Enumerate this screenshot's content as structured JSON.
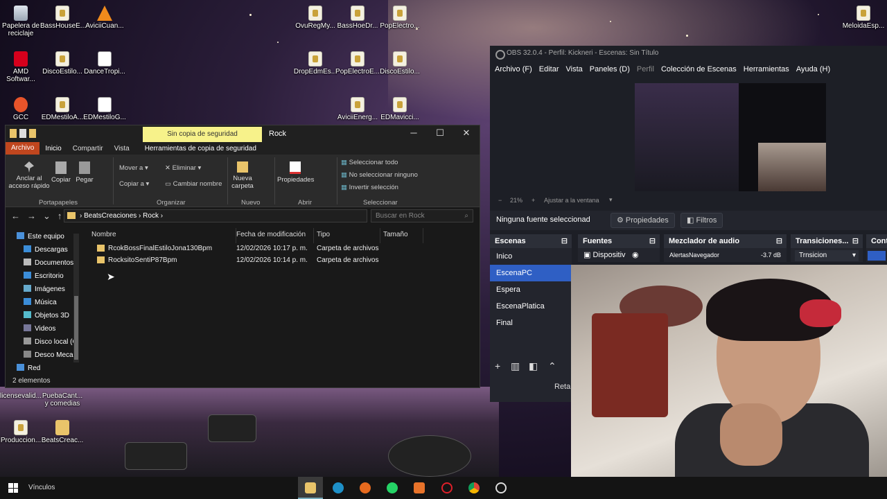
{
  "desktop": {
    "icons": [
      {
        "label": "Papelera de reciclaje"
      },
      {
        "label": "BassHouseE..."
      },
      {
        "label": "AviciiCuan..."
      },
      {
        "label": "OvuRegMy..."
      },
      {
        "label": "BassHoeDr..."
      },
      {
        "label": "PopElectro..."
      },
      {
        "label": "MeloidaEsp..."
      },
      {
        "label": "AMD Softwar..."
      },
      {
        "label": "DiscoEstilo..."
      },
      {
        "label": "DanceTropi..."
      },
      {
        "label": "DropEdmEs..."
      },
      {
        "label": "PopElectroE..."
      },
      {
        "label": "DiscoEstilo..."
      },
      {
        "label": "GCC"
      },
      {
        "label": "EDMestiloA..."
      },
      {
        "label": "EDMestiloG..."
      },
      {
        "label": "AviciiEnerg..."
      },
      {
        "label": "EDMavicci..."
      },
      {
        "label": "licensevalid..."
      },
      {
        "label": "PuebaCant... y comedias"
      },
      {
        "label": "Produccion..."
      },
      {
        "label": "BeatsCreac..."
      }
    ]
  },
  "explorer": {
    "context_tab": "Sin copia de seguridad",
    "title": "Rock",
    "controls": {
      "minimize": "─",
      "maximize": "☐",
      "close": "✕"
    },
    "tabs": {
      "archivo": "Archivo",
      "inicio": "Inicio",
      "compartir": "Compartir",
      "vista": "Vista",
      "herramientas": "Herramientas de copia de seguridad"
    },
    "ribbon": {
      "anclar": "Anclar al acceso rápido",
      "copiar": "Copiar",
      "pegar": "Pegar",
      "mover": "Mover a",
      "copiar_a": "Copiar a",
      "eliminar": "Eliminar",
      "cambiar_nombre": "Cambiar nombre",
      "nueva_carpeta": "Nueva carpeta",
      "propiedades": "Propiedades",
      "seleccionar_todo": "Seleccionar todo",
      "no_seleccionar": "No seleccionar ninguno",
      "invertir": "Invertir selección",
      "groups": {
        "portapapeles": "Portapapeles",
        "organizar": "Organizar",
        "nuevo": "Nuevo",
        "abrir": "Abrir",
        "seleccionar": "Seleccionar"
      }
    },
    "address": {
      "crumb1": "BeatsCreaciones",
      "crumb2": "Rock",
      "search_placeholder": "Buscar en Rock"
    },
    "nav": [
      "Este equipo",
      "Descargas",
      "Documentos",
      "Escritorio",
      "Imágenes",
      "Música",
      "Objetos 3D",
      "Videos",
      "Disco local (C",
      "Desco Mecan",
      "Red"
    ],
    "columns": {
      "name": "Nombre",
      "date": "Fecha de modificación",
      "type": "Tipo",
      "size": "Tamaño"
    },
    "files": [
      {
        "name": "RcokBossFinalEstiloJona130Bpm",
        "date": "12/02/2026 10:17 p. m.",
        "type": "Carpeta de archivos"
      },
      {
        "name": "RocksitoSentiP87Bpm",
        "date": "12/02/2026 10:14 p. m.",
        "type": "Carpeta de archivos"
      }
    ],
    "status": "2 elementos"
  },
  "obs": {
    "title": "OBS 32.0.4 - Perfil: Kickneri - Escenas: Sin Título",
    "menu": [
      "Archivo (F)",
      "Editar",
      "Vista",
      "Paneles (D)",
      "Perfil",
      "Colección de Escenas",
      "Herramientas",
      "Ayuda (H)"
    ],
    "zoom": "21%",
    "zoom_mode": "Ajustar a la ventana",
    "no_source": "Ninguna fuente seleccionad",
    "properties": "Propiedades",
    "filters": "Filtros",
    "docks": {
      "scenes": "Escenas",
      "sources": "Fuentes",
      "mixer": "Mezclador de audio",
      "transitions": "Transiciones...",
      "controls": "Contr"
    },
    "scenes": [
      "Inico",
      "EscenaPC",
      "Espera",
      "EscenaPlatica",
      "Final"
    ],
    "selected_scene": "EscenaPC",
    "source_item": "Dispositiv",
    "mixer_item": "AlertasNavegador",
    "mixer_db": "-3.7 dB",
    "transition": "Trnsicion",
    "retar": "Retar"
  },
  "taskbar": {
    "vinculos": "Vínculos"
  }
}
